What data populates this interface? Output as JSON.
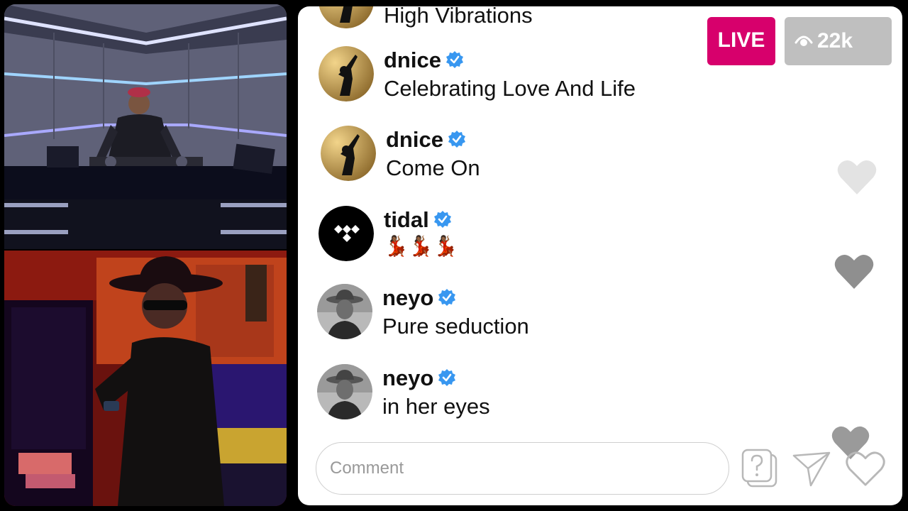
{
  "live": {
    "badge": "LIVE",
    "viewer_count": "22k"
  },
  "comments": [
    {
      "username": "",
      "message": "High Vibrations",
      "avatar": "dnice-logo-avatar"
    },
    {
      "username": "dnice",
      "message": "Celebrating Love And Life",
      "avatar": "dnice-logo-avatar"
    },
    {
      "username": "dnice",
      "message": "Come On",
      "avatar": "dnice-logo-avatar"
    },
    {
      "username": "tidal",
      "message": "💃🏾💃🏾💃🏾",
      "avatar": "tidal-logo-avatar"
    },
    {
      "username": "neyo",
      "message": "Pure seduction",
      "avatar": "neyo-photo-avatar"
    },
    {
      "username": "neyo",
      "message": "in her eyes",
      "avatar": "neyo-photo-avatar"
    }
  ],
  "comment_input": {
    "placeholder": "Comment"
  },
  "icons": {
    "verified": "verified-badge-icon",
    "viewers": "eye-icon",
    "question": "question-icon",
    "share": "send-icon",
    "like": "heart-outline-icon",
    "floating": "heart-icon"
  },
  "colors": {
    "live": "#d7006c",
    "viewers": "#bfbfbf",
    "verified": "#3897f0"
  }
}
